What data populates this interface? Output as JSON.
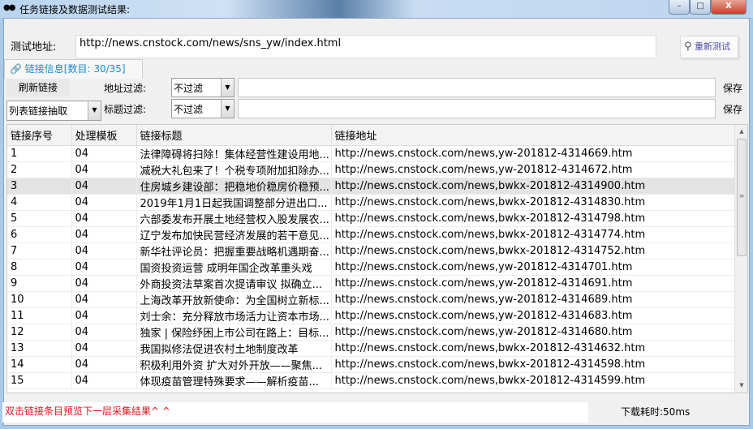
{
  "window": {
    "title": "任务链接及数据测试结果:",
    "min": "–",
    "max": "□",
    "close": "X"
  },
  "test": {
    "label": "测试地址:",
    "url": "http://news.cnstock.com/news/sns_yw/index.html",
    "retest_label": "重新测试"
  },
  "tab": {
    "label": "链接信息[数目: 30/35]"
  },
  "filters": {
    "refresh_label": "刷新链接",
    "mode": "列表链接抽取",
    "addr_label": "地址过滤:",
    "addr_mode": "不过滤",
    "addr_value": "",
    "title_label": "标题过滤:",
    "title_mode": "不过滤",
    "title_value": "",
    "save_label": "保存"
  },
  "table": {
    "columns": [
      "链接序号",
      "处理模板",
      "链接标题",
      "链接地址"
    ],
    "selected_index": 2,
    "rows": [
      [
        "1",
        "04",
        "法律障碍将扫除！集体经营性建设用地...",
        "http://news.cnstock.com/news,yw-201812-4314669.htm"
      ],
      [
        "2",
        "04",
        "减税大礼包来了！个税专项附加扣除办...",
        "http://news.cnstock.com/news,yw-201812-4314672.htm"
      ],
      [
        "3",
        "04",
        "住房城乡建设部：把稳地价稳房价稳预...",
        "http://news.cnstock.com/news,bwkx-201812-4314900.htm"
      ],
      [
        "4",
        "04",
        "2019年1月1日起我国调整部分进出口...",
        "http://news.cnstock.com/news,bwkx-201812-4314830.htm"
      ],
      [
        "5",
        "04",
        "六部委发布开展土地经营权入股发展农...",
        "http://news.cnstock.com/news,bwkx-201812-4314798.htm"
      ],
      [
        "6",
        "04",
        "辽宁发布加快民营经济发展的若干意见...",
        "http://news.cnstock.com/news,bwkx-201812-4314774.htm"
      ],
      [
        "7",
        "04",
        "新华社评论员：把握重要战略机遇期奋...",
        "http://news.cnstock.com/news,bwkx-201812-4314752.htm"
      ],
      [
        "8",
        "04",
        "国资投资运营 成明年国企改革重头戏",
        "http://news.cnstock.com/news,yw-201812-4314701.htm"
      ],
      [
        "9",
        "04",
        "外商投资法草案首次提请审议 拟确立...",
        "http://news.cnstock.com/news,yw-201812-4314691.htm"
      ],
      [
        "10",
        "04",
        "上海改革开放新使命：为全国树立新标...",
        "http://news.cnstock.com/news,yw-201812-4314689.htm"
      ],
      [
        "11",
        "04",
        "刘士余：充分释放市场活力让资本市场...",
        "http://news.cnstock.com/news,yw-201812-4314683.htm"
      ],
      [
        "12",
        "04",
        "独家 | 保险纾困上市公司在路上：目标...",
        "http://news.cnstock.com/news,yw-201812-4314680.htm"
      ],
      [
        "13",
        "04",
        "我国拟修法促进农村土地制度改革",
        "http://news.cnstock.com/news,bwkx-201812-4314632.htm"
      ],
      [
        "14",
        "04",
        "积极利用外资 扩大对外开放——聚焦...",
        "http://news.cnstock.com/news,bwkx-201812-4314598.htm"
      ],
      [
        "15",
        "04",
        "体现疫苗管理特殊要求——解析疫苗...",
        "http://news.cnstock.com/news,bwkx-201812-4314599.htm"
      ]
    ]
  },
  "status": {
    "hint": "双击链接条目预览下一层采集结果^ ^",
    "timing": "下载耗时:50ms"
  },
  "colors": {
    "hint": "#e0141e",
    "tab": "#1a8ad4",
    "selected_row": "#e3e3e3"
  }
}
